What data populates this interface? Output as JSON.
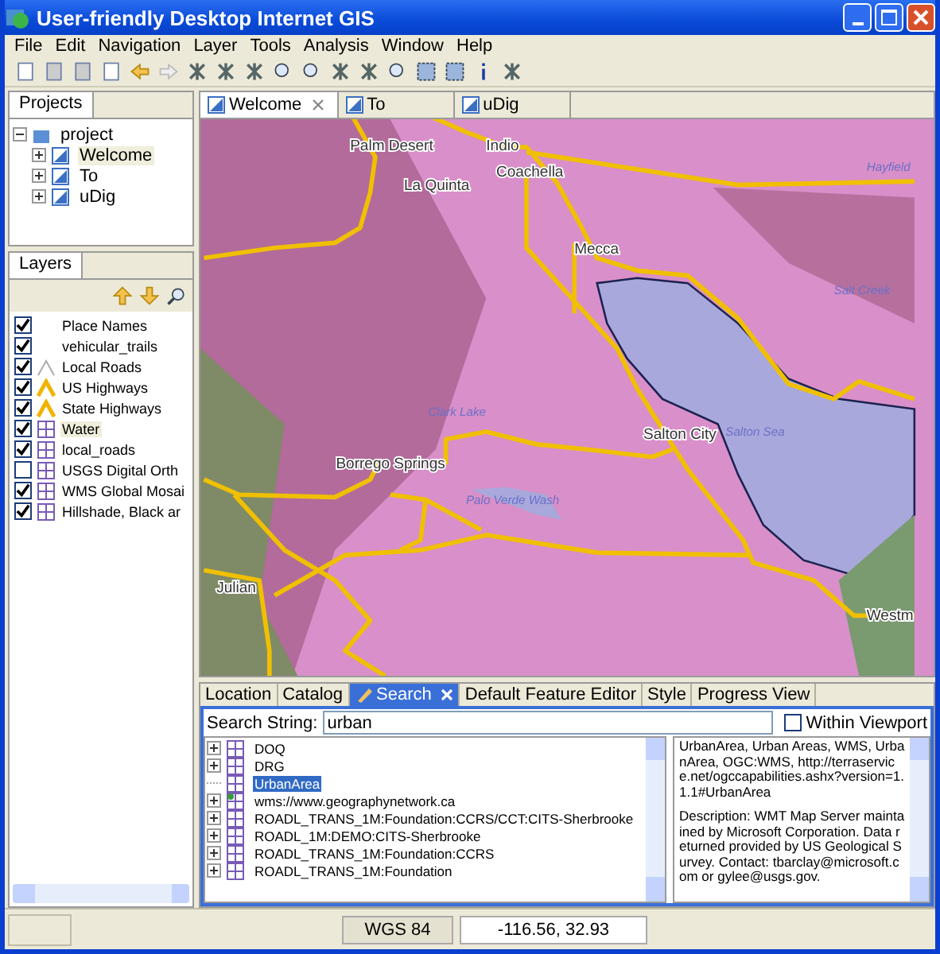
{
  "window": {
    "title": "User-friendly Desktop Internet GIS"
  },
  "menu": [
    "File",
    "Edit",
    "Navigation",
    "Layer",
    "Tools",
    "Analysis",
    "Window",
    "Help"
  ],
  "projects": {
    "title": "Projects",
    "tree": [
      {
        "label": "project",
        "selected": false,
        "children": [
          {
            "label": "Welcome",
            "selected": true
          },
          {
            "label": "To",
            "selected": false
          },
          {
            "label": "uDig",
            "selected": false
          }
        ]
      }
    ]
  },
  "layers": {
    "title": "Layers",
    "items": [
      {
        "label": "Place Names",
        "checked": true,
        "selected": false,
        "kind": "none"
      },
      {
        "label": "vehicular_trails",
        "checked": true,
        "selected": false,
        "kind": "none"
      },
      {
        "label": "Local Roads",
        "checked": true,
        "selected": false,
        "kind": "line"
      },
      {
        "label": "US Highways",
        "checked": true,
        "selected": false,
        "kind": "highway"
      },
      {
        "label": "State Highways",
        "checked": true,
        "selected": false,
        "kind": "highway"
      },
      {
        "label": "Water",
        "checked": true,
        "selected": true,
        "kind": "grid"
      },
      {
        "label": "local_roads",
        "checked": true,
        "selected": false,
        "kind": "grid"
      },
      {
        "label": "USGS Digital Orth",
        "checked": false,
        "selected": false,
        "kind": "grid"
      },
      {
        "label": "WMS Global Mosai",
        "checked": true,
        "selected": false,
        "kind": "grid"
      },
      {
        "label": "Hillshade, Black ar",
        "checked": true,
        "selected": false,
        "kind": "grid"
      }
    ]
  },
  "editor_tabs": [
    {
      "label": "Welcome",
      "selected": true
    },
    {
      "label": "To",
      "selected": false
    },
    {
      "label": "uDig",
      "selected": false
    }
  ],
  "map_labels": [
    {
      "text": "Palm Desert",
      "kind": "city"
    },
    {
      "text": "Indio",
      "kind": "city"
    },
    {
      "text": "Coachella",
      "kind": "city"
    },
    {
      "text": "La Quinta",
      "kind": "city"
    },
    {
      "text": "Mecca",
      "kind": "city"
    },
    {
      "text": "Hayfield",
      "kind": "water"
    },
    {
      "text": "Salt Creek",
      "kind": "water"
    },
    {
      "text": "Clark Lake",
      "kind": "water"
    },
    {
      "text": "Salton City",
      "kind": "city"
    },
    {
      "text": "Salton Sea",
      "kind": "water"
    },
    {
      "text": "Borrego Springs",
      "kind": "city"
    },
    {
      "text": "Palo Verde Wash",
      "kind": "water"
    },
    {
      "text": "Julian",
      "kind": "city"
    },
    {
      "text": "Westm",
      "kind": "city"
    }
  ],
  "bottom_tabs": [
    {
      "label": "Location",
      "selected": false
    },
    {
      "label": "Catalog",
      "selected": false
    },
    {
      "label": "Search",
      "selected": true
    },
    {
      "label": "Default Feature Editor",
      "selected": false
    },
    {
      "label": "Style",
      "selected": false
    },
    {
      "label": "Progress View",
      "selected": false
    }
  ],
  "search": {
    "label": "Search String:",
    "value": "urban",
    "within_viewport": {
      "label": "Within Viewport",
      "checked": false
    }
  },
  "results": [
    {
      "label": "DOQ",
      "expandable": true,
      "selected": false,
      "kind": "layer"
    },
    {
      "label": "DRG",
      "expandable": true,
      "selected": false,
      "kind": "layer"
    },
    {
      "label": "UrbanArea",
      "expandable": false,
      "selected": true,
      "kind": "layer"
    },
    {
      "label": "wms://www.geographynetwork.ca",
      "expandable": true,
      "selected": false,
      "kind": "server"
    },
    {
      "label": "ROADL_TRANS_1M:Foundation:CCRS/CCT:CITS-Sherbrooke",
      "expandable": true,
      "selected": false,
      "kind": "layer"
    },
    {
      "label": "ROADL_1M:DEMO:CITS-Sherbrooke",
      "expandable": true,
      "selected": false,
      "kind": "layer"
    },
    {
      "label": "ROADL_TRANS_1M:Foundation:CCRS",
      "expandable": true,
      "selected": false,
      "kind": "layer"
    },
    {
      "label": "ROADL_TRANS_1M:Foundation",
      "expandable": true,
      "selected": false,
      "kind": "layer"
    }
  ],
  "description": [
    "UrbanArea, Urban Areas, WMS, UrbanArea, OGC:WMS, http://terraservice.net/ogccapabilities.ashx?version=1.1.1#UrbanArea",
    "Description: WMT Map Server maintained by Microsoft Corporation.  Data returned provided by US Geological Survey.  Contact: tbarclay@microsoft.com or gylee@usgs.gov."
  ],
  "status_bar": {
    "crs": "WGS 84",
    "coordinates": "-116.56, 32.93"
  }
}
